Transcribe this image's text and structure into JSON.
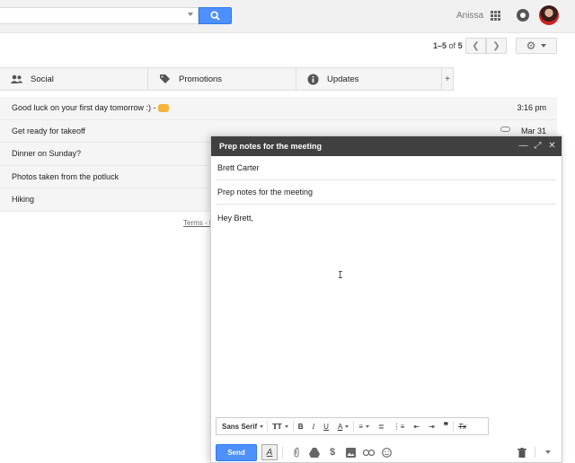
{
  "header": {
    "search": {
      "value": "",
      "placeholder": ""
    },
    "username": "Anissa"
  },
  "toolbar": {
    "pager_range": "1–5",
    "pager_of": "of",
    "pager_total": "5"
  },
  "tabs": [
    {
      "label": "Social",
      "icon": "people-icon"
    },
    {
      "label": "Promotions",
      "icon": "tag-icon"
    },
    {
      "label": "Updates",
      "icon": "info-icon"
    },
    {
      "label": "+",
      "icon": "add-icon"
    }
  ],
  "emails": [
    {
      "subject": "Good luck on your first day tomorrow :) -",
      "time": "3:16 pm",
      "has_emoji": true
    },
    {
      "subject": "Get ready for takeoff",
      "time": "Mar 31",
      "has_attachment": true
    },
    {
      "subject": "Dinner on Sunday?",
      "time": ""
    },
    {
      "subject": "Photos taken from the potluck",
      "time": ""
    },
    {
      "subject": "Hiking",
      "time": ""
    }
  ],
  "footer": {
    "terms": "Terms - P"
  },
  "compose": {
    "title": "Prep notes for the meeting",
    "to": "Brett Carter",
    "subject": "Prep notes for the meeting",
    "body": "Hey Brett,",
    "font": "Sans Serif",
    "send_label": "Send"
  },
  "colors": {
    "accent": "#4d90fe",
    "compose_header": "#404040"
  }
}
